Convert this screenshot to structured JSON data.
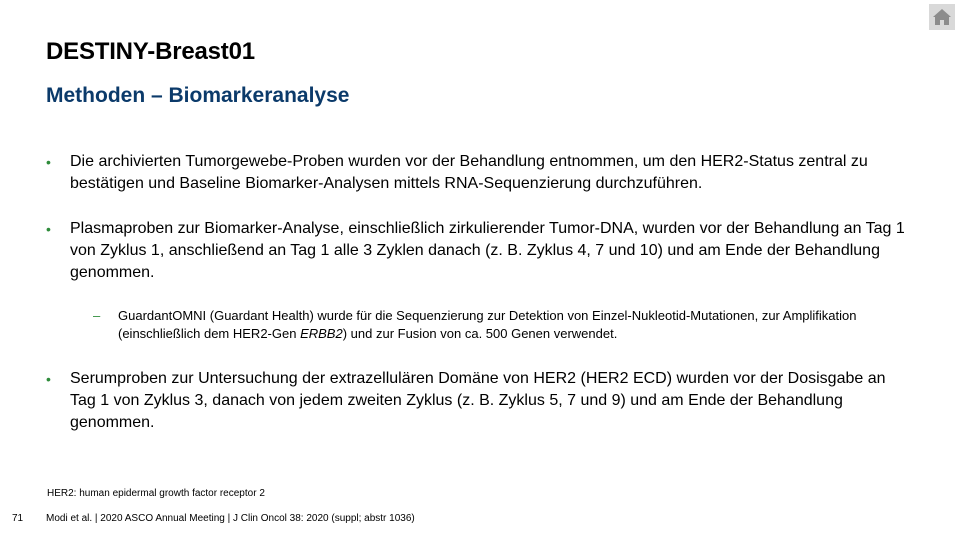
{
  "header": {
    "title": "DESTINY-Breast01",
    "subtitle": "Methoden – Biomarkeranalyse"
  },
  "nav": {
    "home_icon": "home-icon"
  },
  "bullets": [
    {
      "marker": "•",
      "text": "Die archivierten Tumorgewebe-Proben wurden vor der Behandlung entnommen, um den HER2-Status zentral zu bestätigen und Baseline Biomarker-Analysen mittels RNA-Sequenzierung durchzuführen."
    },
    {
      "marker": "•",
      "text": "Plasmaproben zur Biomarker-Analyse, einschließlich zirkulierender Tumor-DNA, wurden vor der Behandlung an Tag 1 von Zyklus 1, anschließend an Tag 1 alle 3 Zyklen danach (z. B. Zyklus 4, 7 und 10) und am Ende der Behandlung genommen."
    },
    {
      "marker": "•",
      "text": "Serumproben zur Untersuchung der extrazellulären Domäne von HER2 (HER2 ECD) wurden vor der Dosisgabe an Tag 1 von Zyklus 3, danach von jedem zweiten Zyklus (z. B. Zyklus 5, 7 und 9) und am Ende der Behandlung genommen."
    }
  ],
  "sub_bullet": {
    "marker": "–",
    "text_before": "GuardantOMNI (Guardant Health) wurde für die Sequenzierung zur Detektion von Einzel-Nukleotid-Mutationen, zur Amplifikation (einschließlich dem HER2-Gen ",
    "text_italic": "ERBB2",
    "text_after": ") und zur Fusion von ca. 500 Genen verwendet."
  },
  "footer": {
    "footnote": "HER2: human epidermal growth factor receptor 2",
    "page_number": "71",
    "citation": "Modi et al. | 2020 ASCO Annual Meeting | J Clin Oncol 38: 2020 (suppl; abstr 1036)"
  },
  "colors": {
    "title": "#000000",
    "subtitle": "#0b3a6a",
    "bullet_marker": "#2e8b3a",
    "home_button_bg": "#d9d9d9",
    "home_icon": "#8c8c8c"
  }
}
